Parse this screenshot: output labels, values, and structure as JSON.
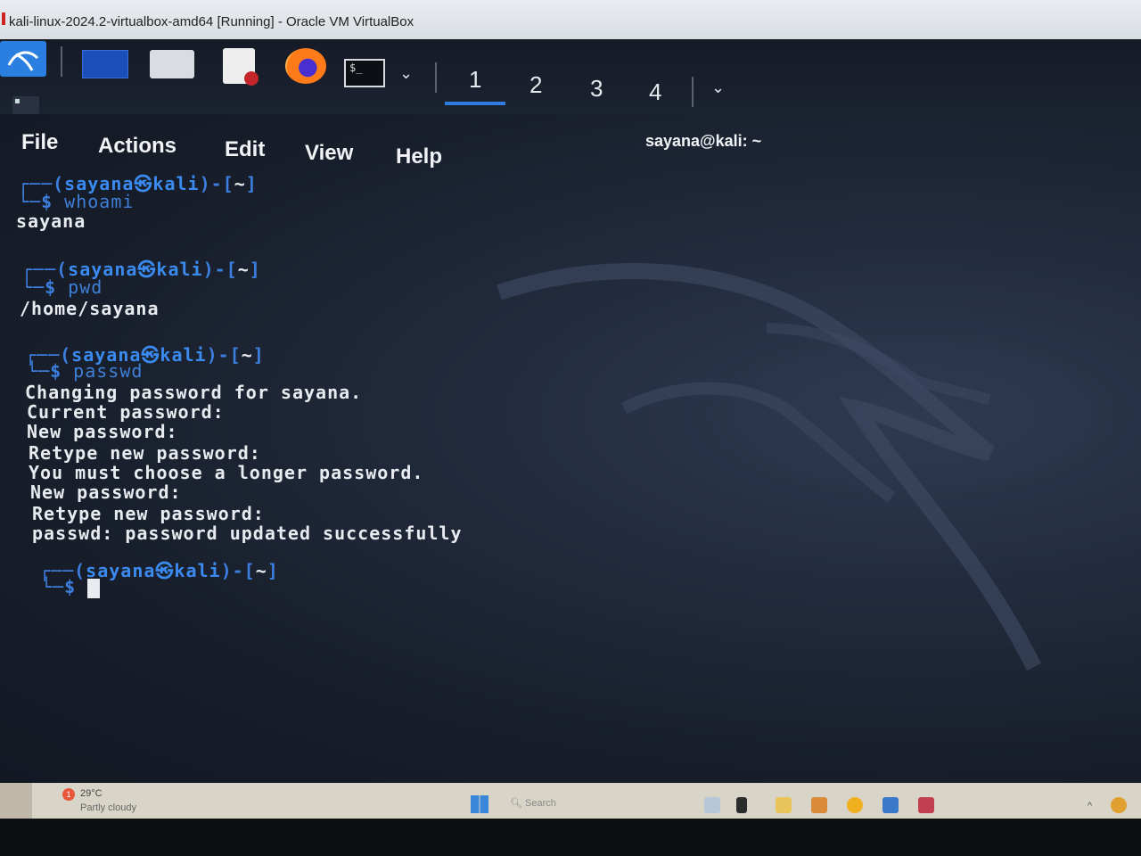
{
  "vbox": {
    "title": "kali-linux-2024.2-virtualbox-amd64 [Running] - Oracle VM VirtualBox"
  },
  "panel": {
    "icons": [
      "kali-menu-icon",
      "desktop-icon",
      "files-icon",
      "text-editor-icon",
      "firefox-icon",
      "terminal-icon",
      "chevron-down-icon"
    ],
    "terminal_icon_text": "$_",
    "workspaces": [
      "1",
      "2",
      "3",
      "4"
    ],
    "active_workspace": "1",
    "window_title": "sayana@kali: ~"
  },
  "terminal": {
    "menu": [
      "File",
      "Actions",
      "Edit",
      "View",
      "Help"
    ],
    "prompt": {
      "user": "sayana",
      "at": "㉿",
      "host": "kali",
      "dir": "~"
    },
    "blocks": [
      {
        "command": "whoami",
        "output": [
          "sayana"
        ]
      },
      {
        "command": "pwd",
        "output": [
          "/home/sayana"
        ]
      },
      {
        "command": "passwd",
        "output": [
          "Changing password for sayana.",
          "Current password:",
          "New password:",
          "Retype new password:",
          "You must choose a longer password.",
          "New password:",
          "Retype new password:",
          "passwd: password updated successfully"
        ]
      },
      {
        "command": "",
        "output": []
      }
    ]
  },
  "host_taskbar": {
    "weather_temp": "29°C",
    "weather_desc": "Partly cloudy",
    "weather_badge": "1",
    "search_placeholder": "Search"
  },
  "colors": {
    "prompt_blue": "#3b8af0",
    "terminal_text": "#e8ebef",
    "panel_bg": "#161b26",
    "accent": "#2f7de1"
  }
}
